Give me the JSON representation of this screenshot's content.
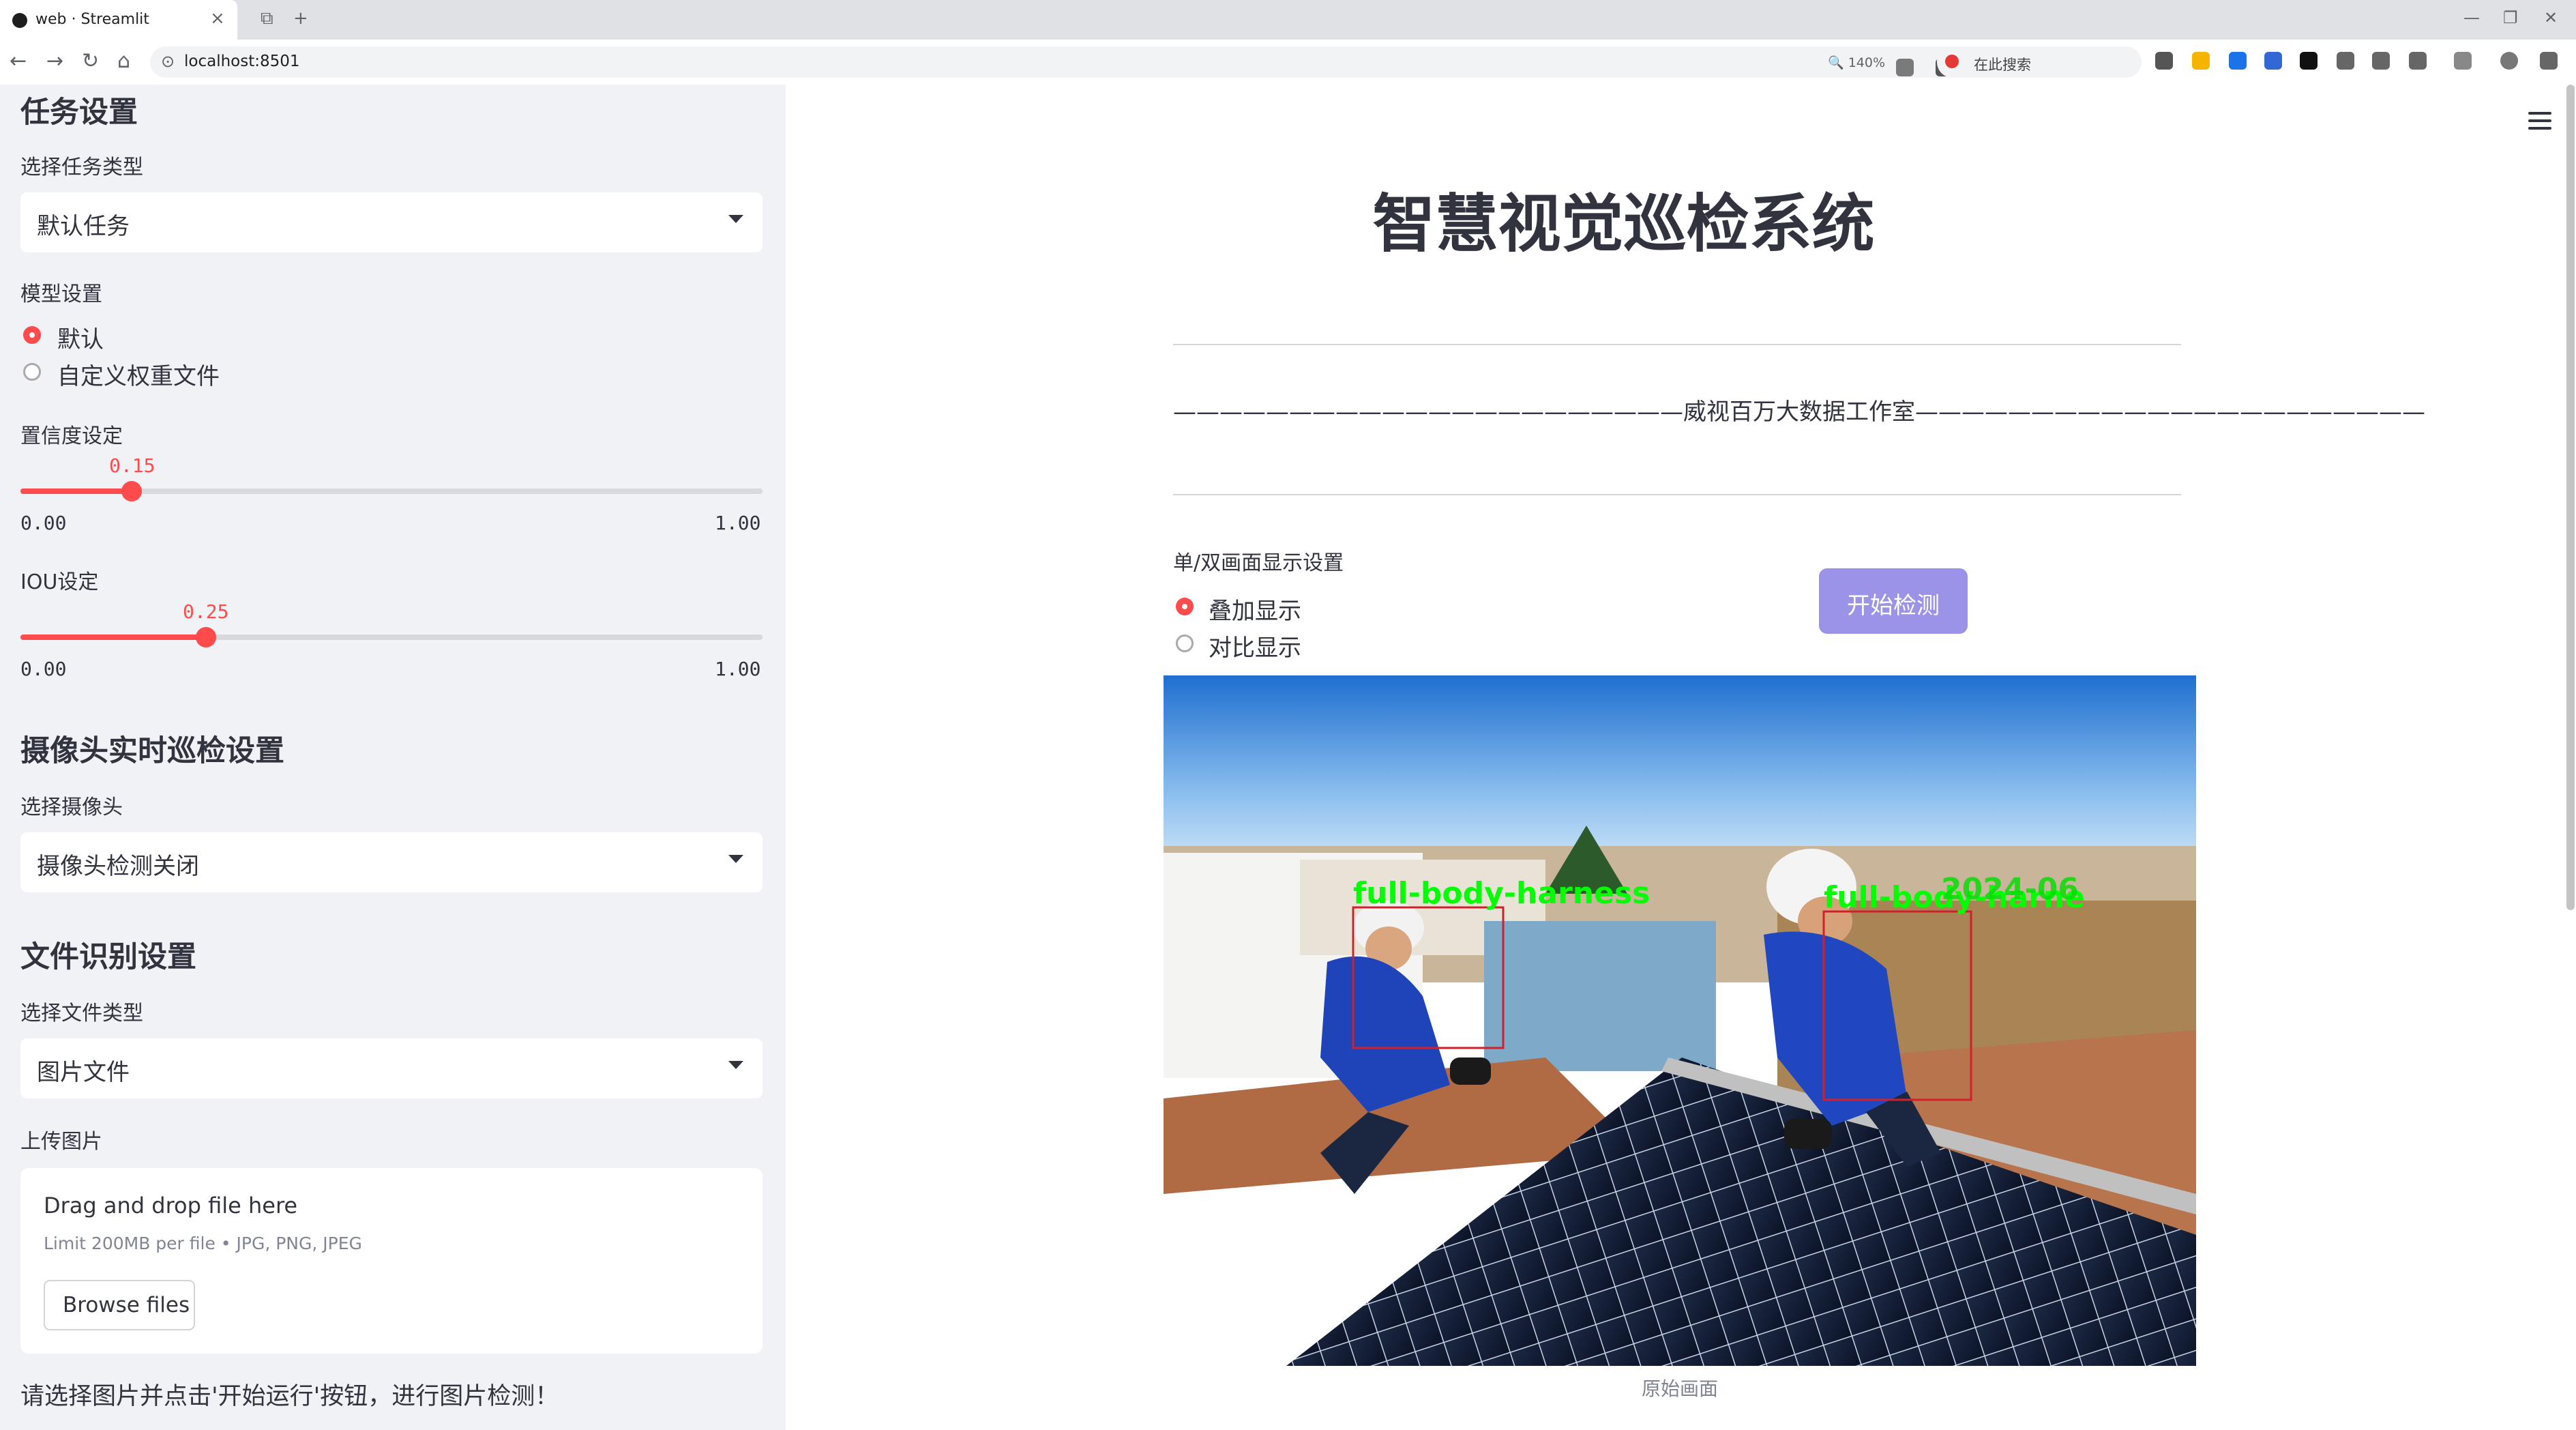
{
  "browser": {
    "tab_title": "web · Streamlit",
    "url": "localhost:8501",
    "zoom": "140%",
    "search_placeholder": "在此搜索"
  },
  "sidebar": {
    "task_section_title": "任务设置",
    "task_type_label": "选择任务类型",
    "task_type_value": "默认任务",
    "model_label": "模型设置",
    "model_options": [
      "默认",
      "自定义权重文件"
    ],
    "model_selected": "默认",
    "confidence": {
      "label": "置信度设定",
      "value": "0.15",
      "min": "0.00",
      "max": "1.00",
      "fraction": 0.15
    },
    "iou": {
      "label": "IOU设定",
      "value": "0.25",
      "min": "0.00",
      "max": "1.00",
      "fraction": 0.25
    },
    "camera_section_title": "摄像头实时巡检设置",
    "camera_label": "选择摄像头",
    "camera_value": "摄像头检测关闭",
    "file_section_title": "文件识别设置",
    "file_type_label": "选择文件类型",
    "file_type_value": "图片文件",
    "upload_label": "上传图片",
    "upload_title": "Drag and drop file here",
    "upload_limit": "Limit 200MB per file • JPG, PNG, JPEG",
    "browse_label": "Browse files",
    "note": "请选择图片并点击'开始运行'按钮，进行图片检测！"
  },
  "main": {
    "title": "智慧视觉巡检系统",
    "subtitle": "——————————————————————威视百万大数据工作室——————————————————————",
    "display_mode_label": "单/双画面显示设置",
    "display_options": [
      "叠加显示",
      "对比显示"
    ],
    "display_selected": "叠加显示",
    "start_button": "开始检测",
    "detections": [
      "full-body-harness",
      "full-body-harne"
    ],
    "overlay_timestamp": "2024-06",
    "caption": "原始画面"
  },
  "colors": {
    "accent": "#ff4b4b",
    "button": "#9b93e8",
    "sidebar_bg": "#f0f2f6",
    "detection_text": "#00ff00",
    "detection_box": "#d0202a"
  }
}
